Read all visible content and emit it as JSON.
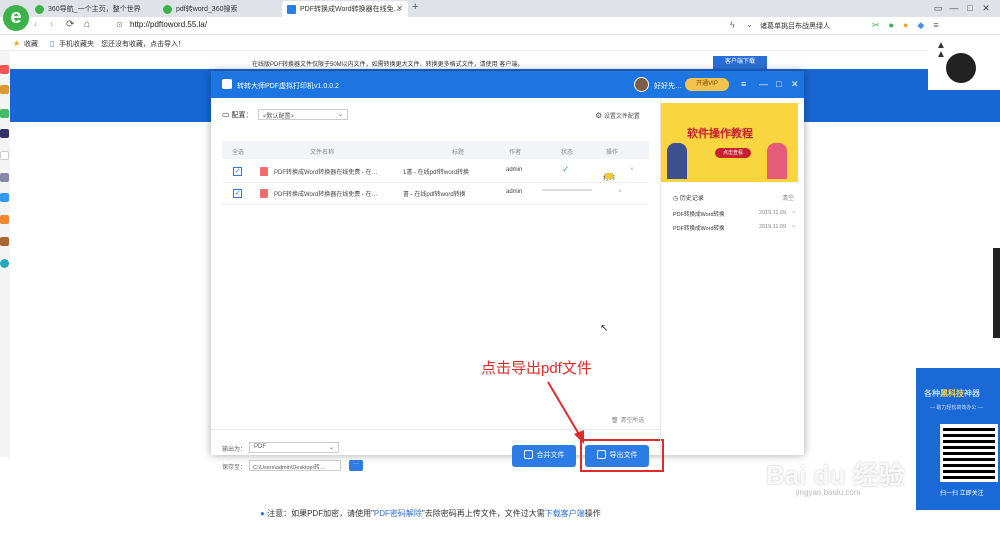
{
  "browser": {
    "tabs": [
      {
        "label": "360导航_一个主页，整个世界",
        "color": "#3cb24a"
      },
      {
        "label": "pdf转word_360搜索",
        "color": "#3cb24a"
      },
      {
        "label": "PDF转换成Word转换器在线免…",
        "color": "#2d7be5"
      }
    ],
    "new_tab": "+",
    "url": "http://pdftoword.55.la/",
    "search_hint": "诸葛单挑吕布战黑绿人",
    "bookmarks": {
      "favorites": "收藏",
      "mobile": "手机收藏夹",
      "empty_hint": "您还没有收藏，点击导入！"
    },
    "logo_glyph": "e"
  },
  "webpage": {
    "notice": "在线版PDF转换器文件仅限于50M以内文件，如需转换更大文件、转换更多格式文件，请使用 客户端。",
    "download_button": "客户端下载",
    "bottom_note_prefix": "注意：如果PDF加密，请使用\"",
    "bottom_note_link1": "PDF密码解除",
    "bottom_note_mid": "\"去除密码再上传文件，文件过大需",
    "bottom_note_link2": "下载客户端",
    "bottom_note_suffix": "操作",
    "watermark": "Bai du 经验",
    "watermark_url": "jingyan.baidu.com",
    "promo_title_prefix": "各种",
    "promo_title_highlight": "黑科技",
    "promo_title_suffix": "神器",
    "promo_sub": "— 助力轻松高效办公 —",
    "promo_footer": "扫一扫 立即关注"
  },
  "app": {
    "title": "转转大师PDF虚拟打印机v1.0.0.2",
    "user": "好好先…",
    "vip": "开通VIP",
    "config_label": "配置：",
    "config_value": "<默认配置>",
    "set_dir": "设置文件配置",
    "columns": [
      "全选",
      "文件名称",
      "标题",
      "作者",
      "状态",
      "操作"
    ],
    "rows": [
      {
        "name": "PDF转换成Word转换器在线免费 - 在…",
        "title": "1書 - 在线pdf转word转换",
        "author": "admin",
        "status": "✓",
        "action": "打开"
      },
      {
        "name": "PDF转换成Word转换器在线免费 - 在…",
        "title": "書 - 在线pdf转word转换",
        "author": "admin",
        "status": "",
        "action": ""
      }
    ],
    "clear_selected": "清空所选",
    "output_label": "输出为：",
    "output_format": "PDF",
    "save_label": "保存至：",
    "save_path": "C:\\Users\\admin\\Desktop\\转…",
    "browse": "···",
    "merge_button": "合并文件",
    "export_button": "导出文件",
    "banner_title": "软件操作教程",
    "banner_sub": "点击查看",
    "history_title": "历史记录",
    "history_clear": "清空",
    "history": [
      {
        "name": "PDF转换成Word转换",
        "date": "2019.11.09"
      },
      {
        "name": "PDF转换成Word转换",
        "date": "2019.11.09"
      }
    ]
  },
  "annotation": "点击导出pdf文件",
  "colors": {
    "accent": "#1c75e0",
    "highlight": "#e02b2b",
    "band": "#1766d3"
  }
}
